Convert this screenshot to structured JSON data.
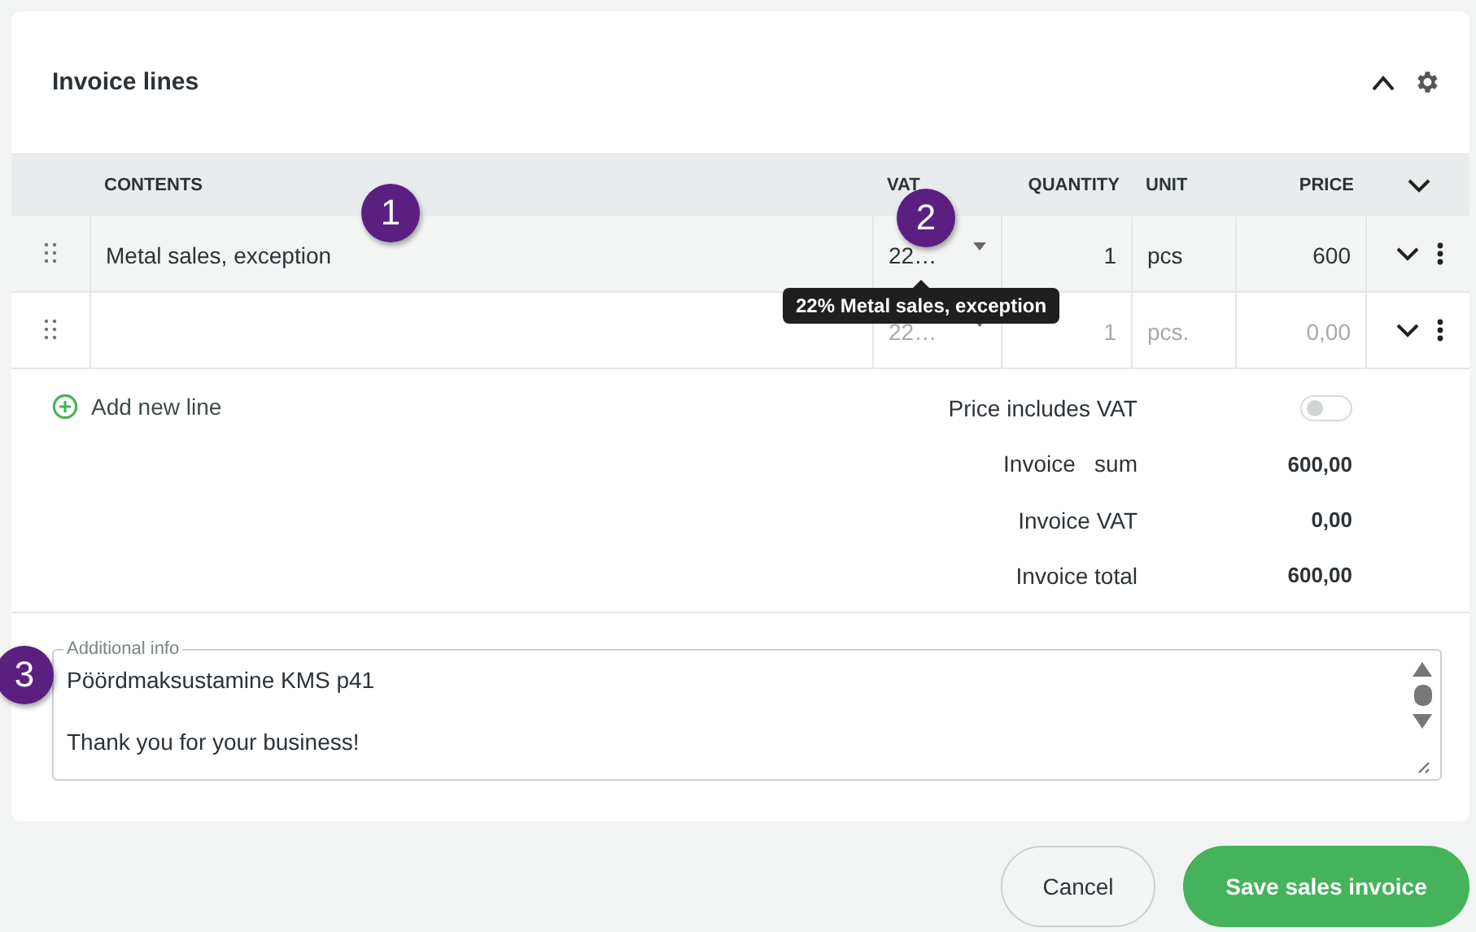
{
  "section": {
    "title": "Invoice lines",
    "expanded": true
  },
  "table": {
    "columns": [
      "CONTENTS",
      "VAT",
      "QUANTITY",
      "UNIT",
      "PRICE"
    ],
    "rows": [
      {
        "contents": "Metal sales, exception",
        "vat": "22…",
        "quantity": "1",
        "unit": "pcs",
        "price": "600",
        "filled": true
      },
      {
        "contents": "",
        "vat": "22…",
        "quantity": "1",
        "unit": "pcs.",
        "price": "0,00",
        "filled": false
      }
    ]
  },
  "tooltip": "22% Metal sales, exception",
  "add_line": "Add new line",
  "price_includes_vat": {
    "label": "Price includes VAT",
    "on": false
  },
  "totals": [
    {
      "label": "Invoice   sum",
      "value": "600,00"
    },
    {
      "label": "Invoice VAT",
      "value": "0,00"
    },
    {
      "label": "Invoice total",
      "value": "600,00"
    }
  ],
  "additional_info": {
    "label": "Additional info",
    "value": "Pöördmaksustamine KMS p41\n\nThank you for your business!"
  },
  "callouts": [
    "1",
    "2",
    "3"
  ],
  "buttons": {
    "cancel": "Cancel",
    "save": "Save sales invoice"
  }
}
